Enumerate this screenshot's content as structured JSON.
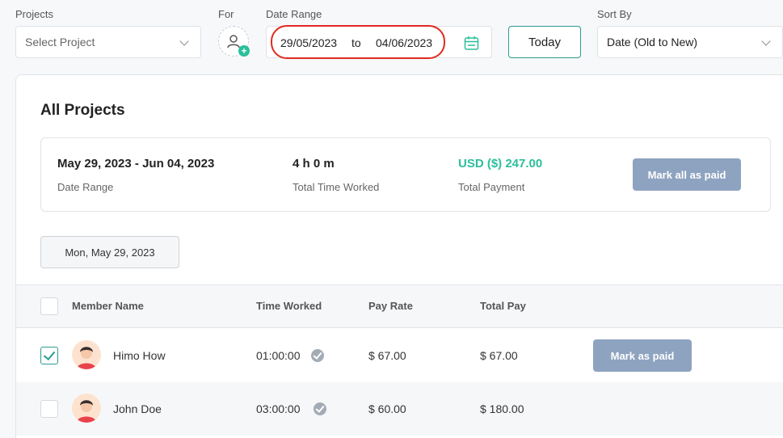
{
  "filters": {
    "projects_label": "Projects",
    "projects_placeholder": "Select Project",
    "for_label": "For",
    "date_range_label": "Date Range",
    "date_from": "29/05/2023",
    "date_sep": "to",
    "date_to": "04/06/2023",
    "today_label": "Today",
    "sort_label": "Sort By",
    "sort_value": "Date (Old to New)"
  },
  "panel": {
    "title": "All Projects",
    "summary": {
      "date_range_value": "May 29, 2023 - Jun 04, 2023",
      "date_range_label": "Date Range",
      "time_value": "4 h 0 m",
      "time_label": "Total Time Worked",
      "payment_value": "USD ($) 247.00",
      "payment_label": "Total Payment",
      "mark_all_label": "Mark all as paid"
    },
    "day_chip": "Mon, May 29, 2023",
    "columns": [
      "Member Name",
      "Time Worked",
      "Pay Rate",
      "Total Pay"
    ],
    "rows": [
      {
        "name": "Himo How",
        "time": "01:00:00",
        "rate": "$ 67.00",
        "total": "$ 67.00",
        "action": "Mark as paid",
        "checked": true
      },
      {
        "name": "John Doe",
        "time": "03:00:00",
        "rate": "$ 60.00",
        "total": "$ 180.00",
        "action": "",
        "checked": false
      }
    ]
  },
  "colors": {
    "accent": "#2a9d8f",
    "payment": "#2bbf9b",
    "button": "#8ea3c0",
    "highlight": "#e02a1f"
  }
}
